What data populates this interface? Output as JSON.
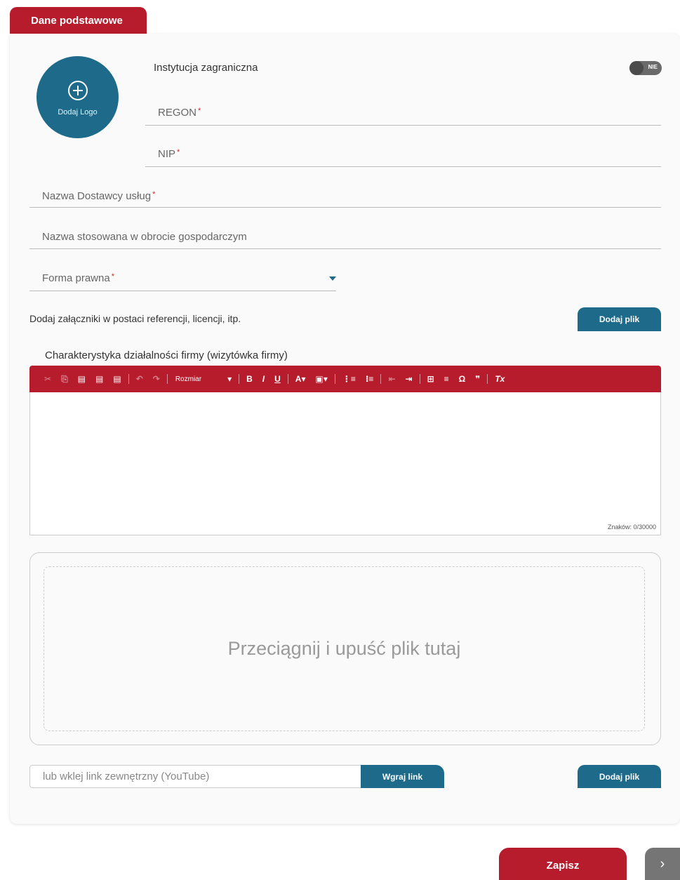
{
  "tab": {
    "label": "Dane podstawowe"
  },
  "logo": {
    "label": "Dodaj Logo",
    "icon": "plus-circle-icon"
  },
  "foreign": {
    "label": "Instytucja zagraniczna",
    "toggle_value": "NIE"
  },
  "fields": {
    "regon": "REGON",
    "nip": "NIP",
    "provider_name": "Nazwa Dostawcy usług",
    "trade_name": "Nazwa stosowana w obrocie gospodarczym",
    "legal_form": "Forma prawna"
  },
  "required_mark": "*",
  "attachments": {
    "label": "Dodaj załączniki w postaci referencji, licencji, itp.",
    "button": "Dodaj plik"
  },
  "editor": {
    "label": "Charakterystyka działalności firmy (wizytówka firmy)",
    "toolbar": {
      "cut": "✂",
      "copy": "⎘",
      "paste": "▤",
      "paste_text": "▤",
      "paste_word": "▤",
      "undo": "↶",
      "redo": "↷",
      "size": "Rozmiar",
      "size_arrow": "▾",
      "bold": "B",
      "italic": "I",
      "underline": "U",
      "text_color": "A▾",
      "bg_color": "▣▾",
      "ordered_list": "⋮≡",
      "bullet_list": "⁝≡",
      "outdent": "⇤",
      "indent": "⇥",
      "table": "⊞",
      "hr": "≡",
      "special_char": "Ω",
      "blockquote": "❞",
      "remove_format": "Tx"
    },
    "char_count": "Znaków: 0/30000"
  },
  "dropzone": {
    "text": "Przeciągnij i upuść plik tutaj"
  },
  "link": {
    "placeholder": "lub wklej link zewnętrzny (YouTube)",
    "upload_button": "Wgraj link",
    "add_file_button": "Dodaj plik"
  },
  "footer": {
    "save": "Zapisz",
    "next": "›"
  },
  "colors": {
    "primary_red": "#b71c2c",
    "primary_blue": "#1d6a8a",
    "next_gray": "#757575"
  }
}
